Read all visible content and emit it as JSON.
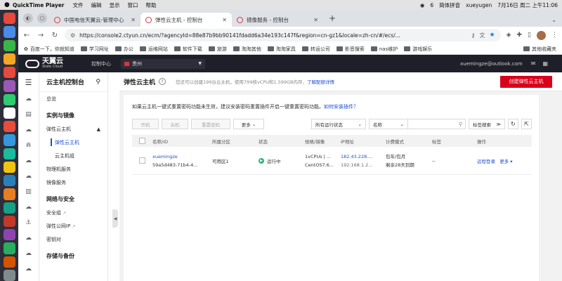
{
  "menubar": {
    "app_name": "QuickTime Player",
    "menus": [
      "文件",
      "编辑",
      "显示",
      "窗口",
      "帮助"
    ],
    "wechat_count": "6",
    "input_method": "简体拼音",
    "user": "xueyugen",
    "datetime": "7月16日 周二 上午11:06"
  },
  "browser": {
    "tabs": [
      {
        "title": "中国电信天翼云-管理中心",
        "active": false
      },
      {
        "title": "弹性云主机 - 控制台",
        "active": true
      },
      {
        "title": "镜像服务 - 控制台",
        "active": false
      }
    ],
    "url": "https://console2.ctyun.cn/ecm/?agencyId=88e87b9bb90141fdadd6a34e193c147f&region=cn-gz1&locale=zh-cn/#/ecs/...",
    "bookmarks": [
      "百度一下，你就知道",
      "学习网址",
      "办公",
      "运维网站",
      "软件下载",
      "旅游",
      "淘淘其他",
      "淘淘家具",
      "转运公司",
      "影音搜索",
      "nas维护",
      "游戏娱乐"
    ],
    "other_bookmarks": "其他收藏夹"
  },
  "console": {
    "brand": "天翼云",
    "brand_sub": "State Cloud",
    "control_center": "控制中心",
    "region": "贵州",
    "email": "xuemingze@outlook.com",
    "sidebar": {
      "title": "云主机控制台",
      "overview": "总览",
      "section_instances": "实例与镜像",
      "ecs": "弹性云主机",
      "ecs_sub": "弹性云主机",
      "ecs_group": "云主机组",
      "physical": "物理机服务",
      "image": "镜像服务",
      "section_network": "网络与安全",
      "security_group": "安全组",
      "eip": "弹性公网IP",
      "keypair": "密钥对",
      "section_storage": "存储与备份"
    },
    "main": {
      "title": "弹性云主机",
      "quota_text": "您还可以创建199台云主机，使用799核vCPU和1,599GB内存，",
      "quota_link": "了解配额详情",
      "create_button": "创建弹性云主机",
      "notice": "如果云主机一键式重置密码功能未生效，建议安装密码重置插件开启一键重置密码功能。",
      "notice_link": "如何安装插件？",
      "buttons": {
        "start": "开机",
        "stop": "关机",
        "reset_pwd": "重置密码",
        "more": "更多"
      },
      "filter_status": "所有运行状态",
      "filter_field": "名称",
      "tag_search": "标签搜索",
      "columns": [
        "名称/ID",
        "所属分区",
        "状态",
        "规格/镜像",
        "IP地址",
        "计费模式",
        "标签",
        "操作"
      ],
      "rows": [
        {
          "name": "xuemingze",
          "id": "59a5d483-71b4-4...",
          "zone": "可用区1",
          "status": "运行中",
          "spec": "1vCPUs | ...",
          "image": "CentOS7.6...",
          "ip_public": "182.43.228....",
          "ip_private": "192.168.1.2...",
          "billing": "包年/包月",
          "billing_remain": "剩余28天到期",
          "tag": "--",
          "op_login": "远程登录",
          "op_more": "更多"
        }
      ]
    }
  },
  "colors": {
    "accent": "#1f4fd1",
    "create": "#d9001b",
    "running": "#2eb873",
    "topnav": "#1f1f29"
  }
}
